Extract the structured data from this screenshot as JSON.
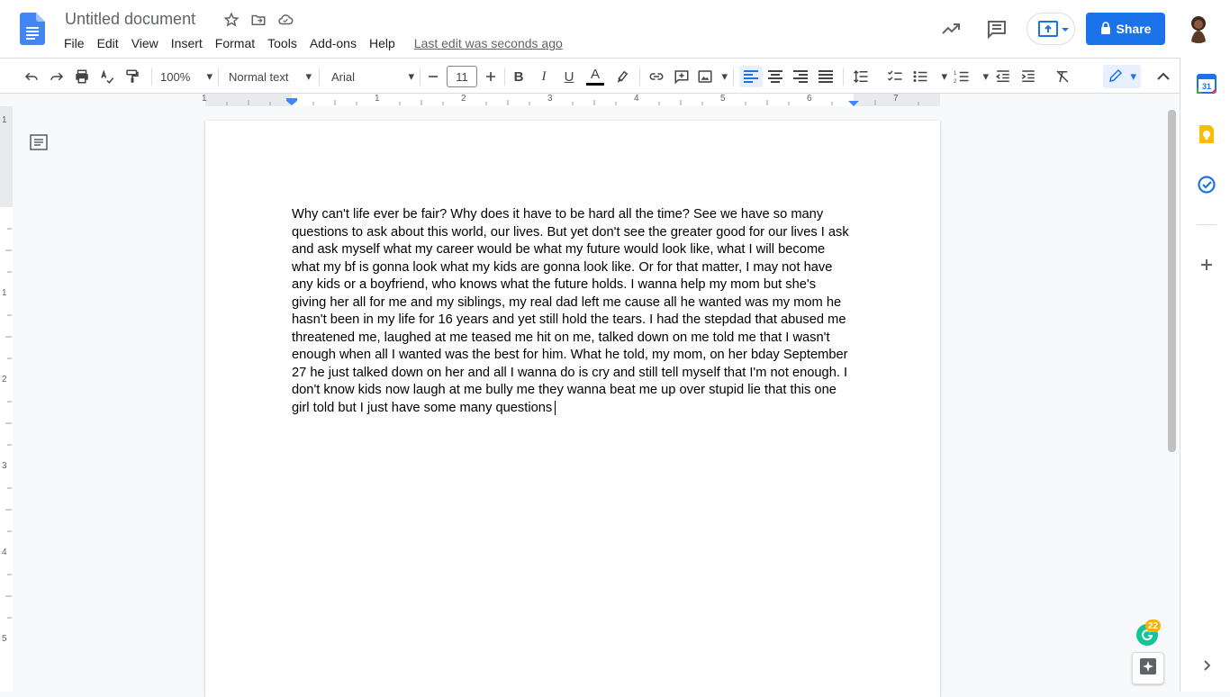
{
  "document": {
    "title": "Untitled document",
    "last_edit": "Last edit was seconds ago",
    "body_text": "Why can't life ever be fair? Why does it have to be hard all the time? See we have so many questions to ask about this world, our lives. But yet don't see the greater good for our lives I ask and ask myself what my career would be what my future would look like, what I will become what my bf is gonna look what my kids are gonna look like. Or for that matter, I may not have any kids or a boyfriend, who knows what the future holds. I wanna help my mom but she's giving her all for me and my siblings, my real dad left me cause all he wanted was my mom he hasn't been in my life for 16 years and yet still hold the tears. I had the stepdad that abused me threatened me, laughed at me teased me hit on me, talked down on me told me that I wasn't enough when all I wanted was the best for him. What he told, my mom, on her bday September 27 he just talked down on her and all I wanna do is cry and still tell myself that I'm not enough. I don't know kids now laugh at me bully me they wanna beat me up over stupid lie that this one girl told but I just have some many questions"
  },
  "menu": [
    "File",
    "Edit",
    "View",
    "Insert",
    "Format",
    "Tools",
    "Add-ons",
    "Help"
  ],
  "header": {
    "share_label": "Share"
  },
  "toolbar": {
    "zoom": "100%",
    "style": "Normal text",
    "font": "Arial",
    "font_size": "11"
  },
  "ruler": {
    "marks": [
      "1",
      "1",
      "2",
      "3",
      "4",
      "5",
      "6",
      "7"
    ]
  },
  "vruler": {
    "marks": [
      "1",
      "1",
      "2",
      "3",
      "4",
      "5"
    ]
  },
  "grammarly": {
    "count": "22"
  },
  "colors": {
    "accent": "#1a73e8",
    "share_bg": "#1a73e8",
    "docs_blue": "#4285f4"
  }
}
